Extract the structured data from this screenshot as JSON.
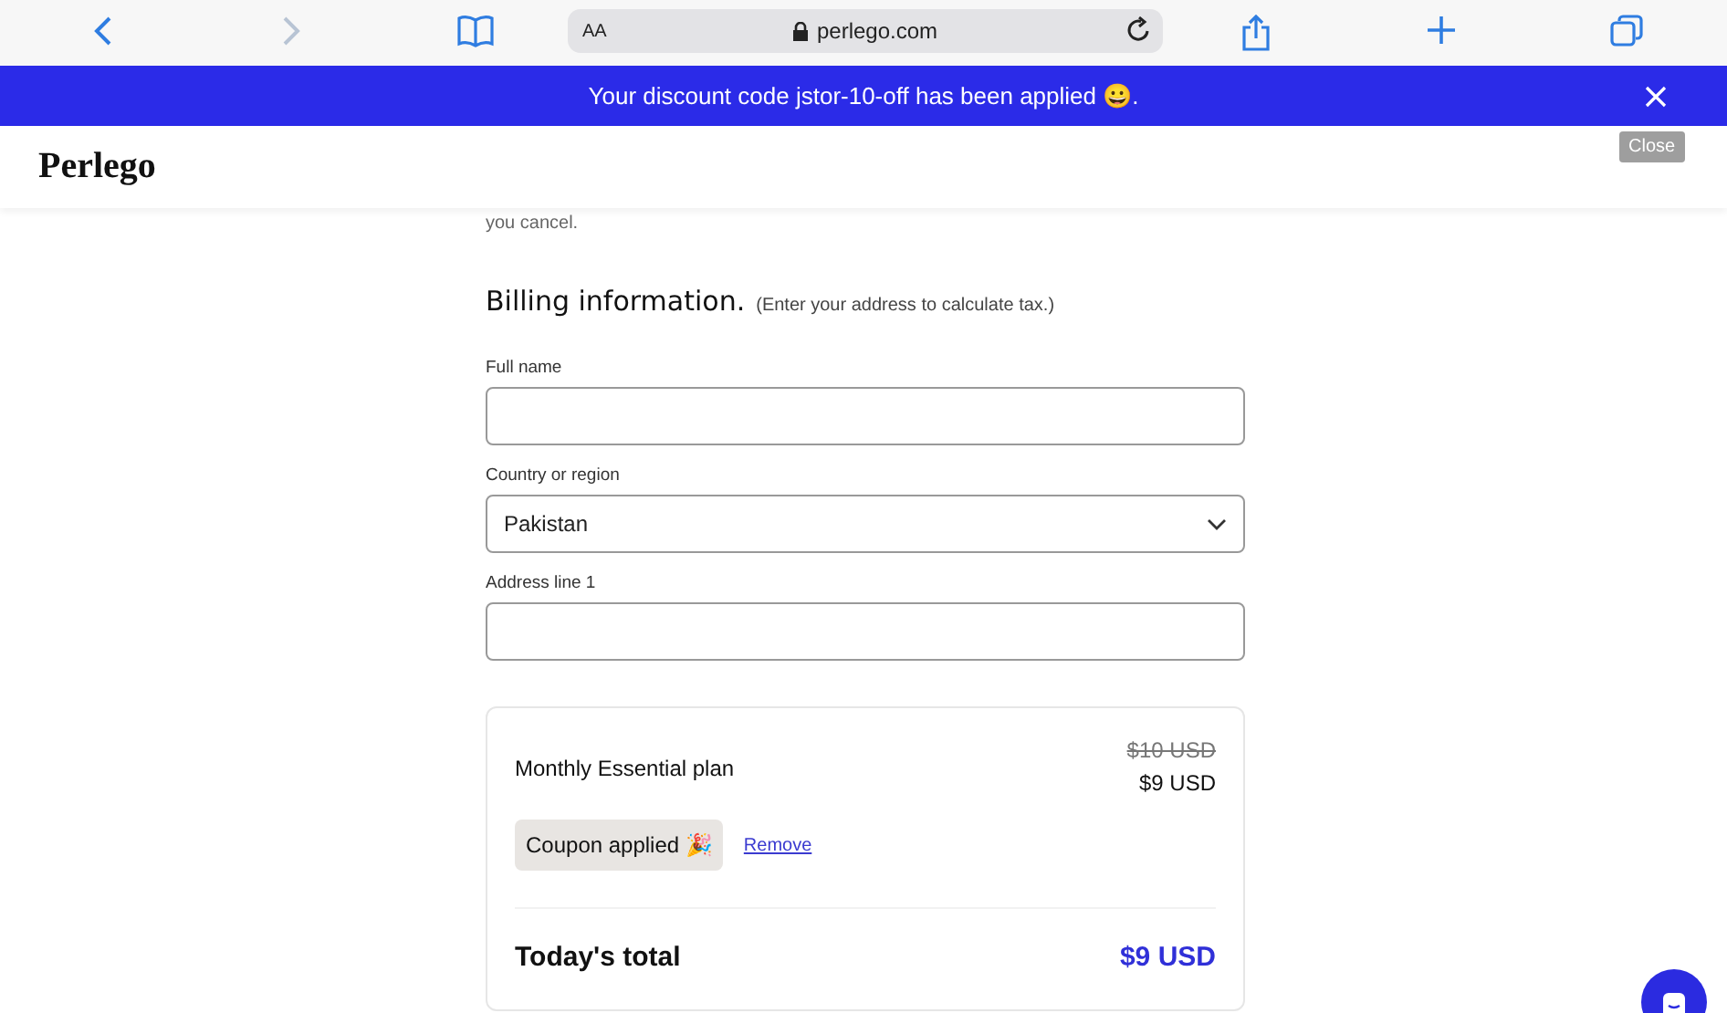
{
  "browser": {
    "text_size": "AA",
    "url": "perlego.com"
  },
  "banner": {
    "message": "Your discount code jstor-10-off has been applied 😀.",
    "close_tooltip": "Close"
  },
  "header": {
    "logo": "Perlego"
  },
  "intro": {
    "line": "you cancel."
  },
  "billing": {
    "title": "Billing information.",
    "hint": "(Enter your address to calculate tax.)",
    "fields": [
      {
        "label": "Full name",
        "kind": "text"
      },
      {
        "label": "Country or region",
        "kind": "select",
        "value": "Pakistan"
      },
      {
        "label": "Address line 1",
        "kind": "text"
      }
    ]
  },
  "summary": {
    "plan": "Monthly Essential plan",
    "old_price": "$10 USD",
    "price": "$9 USD",
    "coupon": "Coupon applied 🎉",
    "remove": "Remove",
    "total_label": "Today's total",
    "total": "$9 USD"
  }
}
